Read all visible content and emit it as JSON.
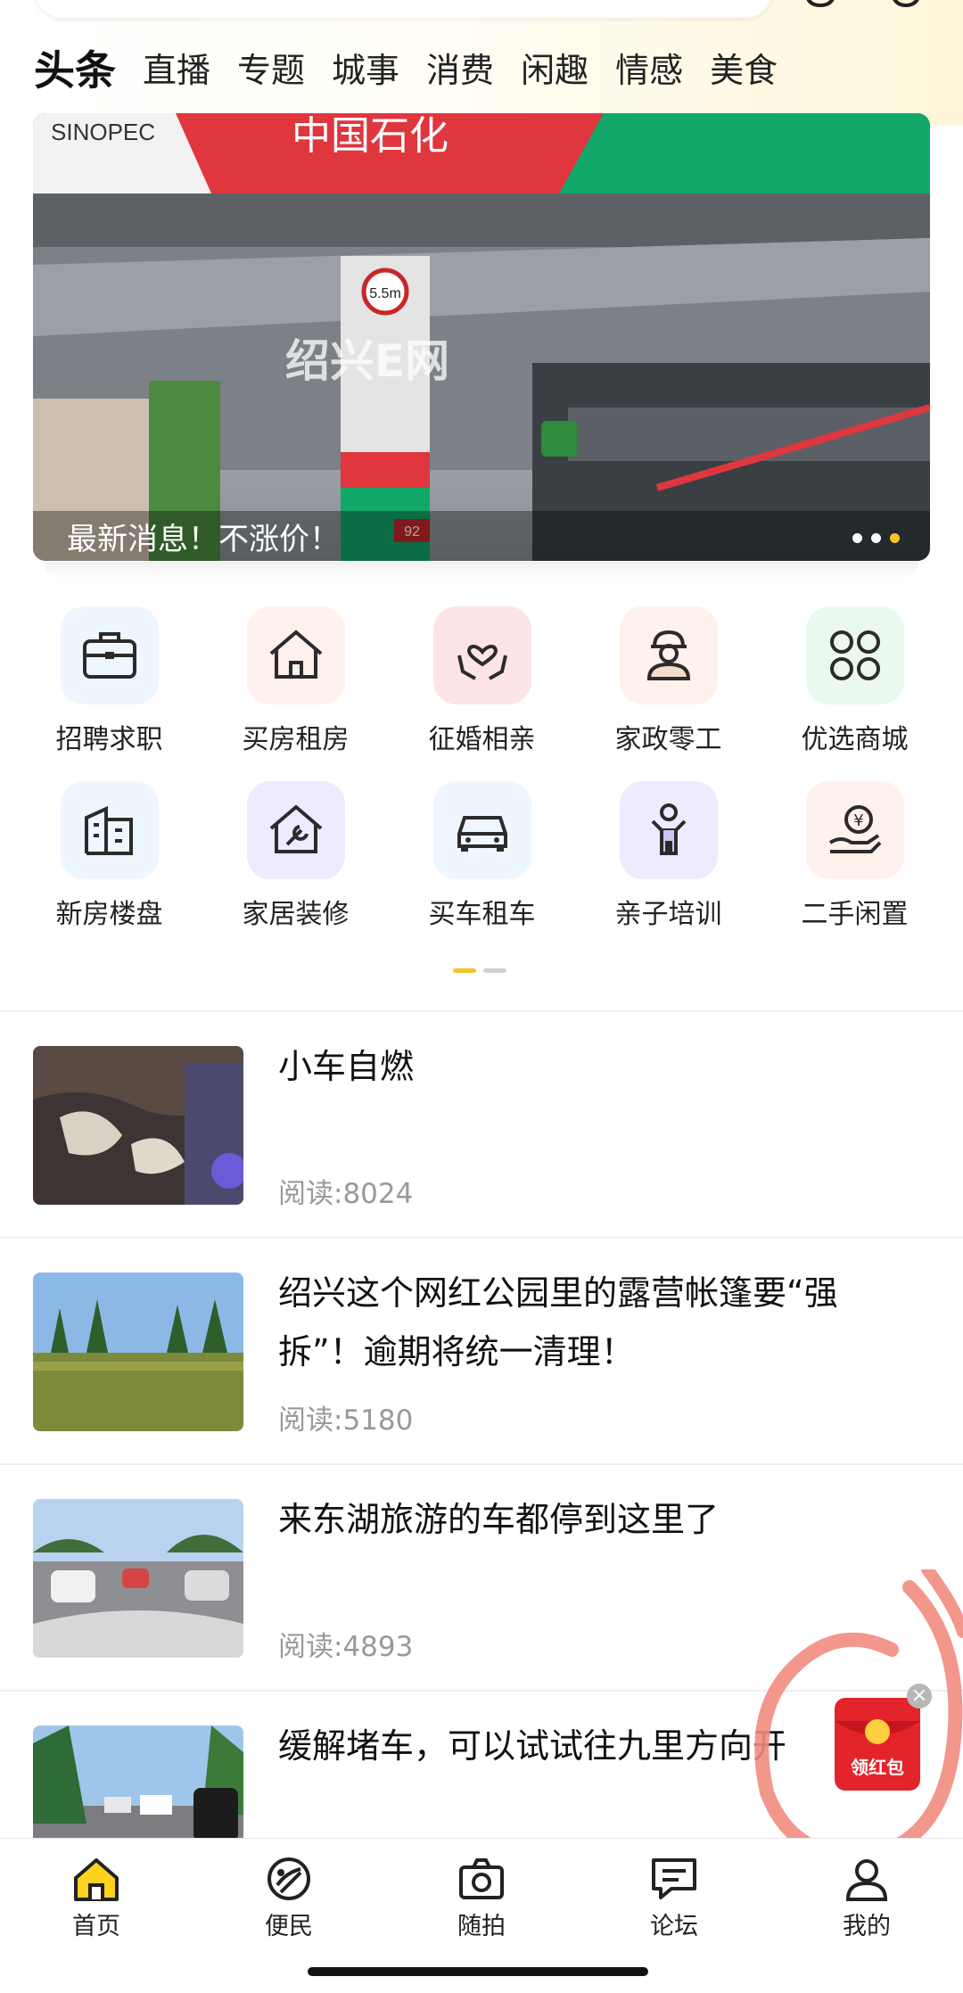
{
  "tabs": [
    {
      "label": "头条",
      "active": true
    },
    {
      "label": "直播"
    },
    {
      "label": "专题"
    },
    {
      "label": "城事"
    },
    {
      "label": "消费"
    },
    {
      "label": "闲趣"
    },
    {
      "label": "情感"
    },
    {
      "label": "美食"
    }
  ],
  "banner": {
    "caption": "最新消息！不涨价！",
    "sign_text": "中国石化",
    "brand_text": "SINOPEC",
    "watermark": "绍兴E网",
    "height_sign": "5.5m",
    "price_sign": "92",
    "dots_total": 3,
    "dots_active_index": 2
  },
  "services": [
    {
      "label": "招聘求职",
      "icon": "briefcase-icon",
      "bg": "#eef6ff"
    },
    {
      "label": "买房租房",
      "icon": "house-icon",
      "bg": "#fff1ec"
    },
    {
      "label": "征婚相亲",
      "icon": "heart-hands-icon",
      "bg": "#fde4e6"
    },
    {
      "label": "家政零工",
      "icon": "worker-icon",
      "bg": "#fff1ec"
    },
    {
      "label": "优选商城",
      "icon": "grid-flower-icon",
      "bg": "#e9f9ee"
    },
    {
      "label": "新房楼盘",
      "icon": "building-icon",
      "bg": "#eef6ff"
    },
    {
      "label": "家居装修",
      "icon": "house-wrench-icon",
      "bg": "#efeaff"
    },
    {
      "label": "买车租车",
      "icon": "car-icon",
      "bg": "#eef6ff"
    },
    {
      "label": "亲子培训",
      "icon": "child-icon",
      "bg": "#efeaff"
    },
    {
      "label": "二手闲置",
      "icon": "money-hand-icon",
      "bg": "#fff1ec"
    }
  ],
  "grid_pages": {
    "total": 2,
    "active_index": 0
  },
  "news": [
    {
      "title": "小车自燃",
      "read": "阅读:8024",
      "thumb": "burnt-car-door"
    },
    {
      "title": "绍兴这个网红公园里的露营帐篷要“强拆”！逾期将统一清理！",
      "read": "阅读:5180",
      "thumb": "park-lawn"
    },
    {
      "title": "来东湖旅游的车都停到这里了",
      "read": "阅读:4893",
      "thumb": "parked-cars"
    },
    {
      "title": "缓解堵车，可以试试往九里方向开",
      "read": "",
      "thumb": "road-traffic"
    }
  ],
  "red_packet": {
    "label": "领红包",
    "close": "×"
  },
  "nav": [
    {
      "label": "首页",
      "icon": "home-icon",
      "active": true
    },
    {
      "label": "便民",
      "icon": "convenience-icon"
    },
    {
      "label": "随拍",
      "icon": "camera-icon"
    },
    {
      "label": "论坛",
      "icon": "chat-icon"
    },
    {
      "label": "我的",
      "icon": "user-icon"
    }
  ],
  "colors": {
    "accent": "#ffd21e",
    "dot_active": "#f7c325",
    "read_gray": "#999999",
    "red_packet": "#e3242b"
  }
}
